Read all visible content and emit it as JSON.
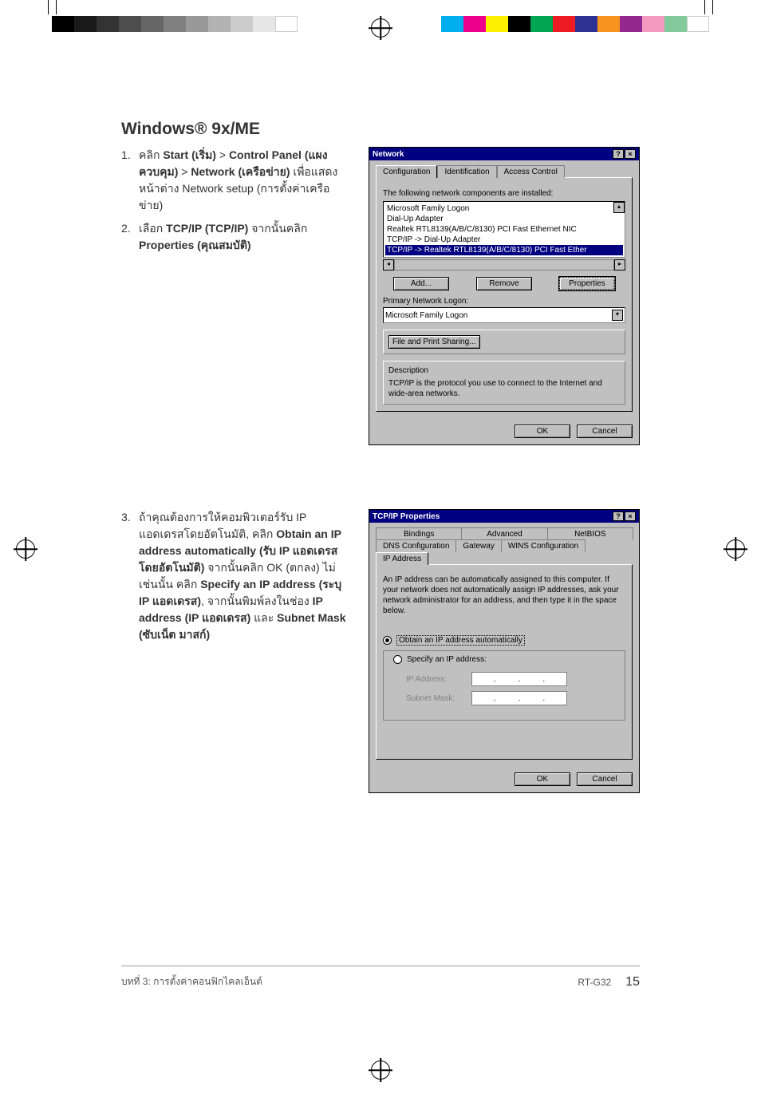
{
  "heading": "Windows® 9x/ME",
  "steps": {
    "s1": {
      "num": "1.",
      "t1": "คลิก ",
      "b1": "Start (เริ่ม)",
      "t2": " > ",
      "b2": "Control Panel (แผงควบคุม)",
      "t3": " > ",
      "b3": "Network (เครือข่าย)",
      "t4": " เพื่อแสดงหน้าต่าง Network setup (การตั้งค่าเครือข่าย)"
    },
    "s2": {
      "num": "2.",
      "t1": "เลือก ",
      "b1": "TCP/IP (TCP/IP)",
      "t2": " จากนั้นคลิก ",
      "b2": "Properties (คุณสมบัติ)"
    },
    "s3": {
      "num": "3.",
      "t1": "ถ้าคุณต้องการให้คอมพิวเตอร์รับ IP แอดเดรสโดยอัตโนมัติ, คลิก ",
      "b1": "Obtain an IP address automatically (รับ IP แอดเดรสโดยอัตโนมัติ)",
      "t2": " จากนั้นคลิก OK (ตกลง) ไม่เช่นนั้น คลิก ",
      "b2": "Specify an IP address (ระบุ IP แอดเดรส)",
      "t3": ", จากนั้นพิมพ์ลงในช่อง ",
      "b3": "IP address (IP แอดเดรส)",
      "t4": " และ ",
      "b4": "Subnet Mask (ซับเน็ต มาสก์)"
    }
  },
  "dlg1": {
    "title": "Network",
    "tabs": {
      "t1": "Configuration",
      "t2": "Identification",
      "t3": "Access Control"
    },
    "components_label": "The following network components are installed:",
    "items": {
      "i1": "Microsoft Family Logon",
      "i2": "Dial-Up Adapter",
      "i3": "Realtek RTL8139(A/B/C/8130) PCI Fast Ethernet NIC",
      "i4": "TCP/IP -> Dial-Up Adapter",
      "i5": "TCP/IP -> Realtek RTL8139(A/B/C/8130) PCI Fast Ether"
    },
    "btn_add": "Add...",
    "btn_remove": "Remove",
    "btn_props": "Properties",
    "primary_label": "Primary Network Logon:",
    "primary_value": "Microsoft Family Logon",
    "btn_fps": "File and Print Sharing...",
    "desc_label": "Description",
    "desc_text": "TCP/IP is the protocol you use to connect to the Internet and wide-area networks.",
    "ok": "OK",
    "cancel": "Cancel"
  },
  "dlg2": {
    "title": "TCP/IP Properties",
    "tabs": {
      "r1a": "Bindings",
      "r1b": "Advanced",
      "r1c": "NetBIOS",
      "r2a": "DNS Configuration",
      "r2b": "Gateway",
      "r2c": "WINS Configuration",
      "r2d": "IP Address"
    },
    "intro": "An IP address can be automatically assigned to this computer. If your network does not automatically assign IP addresses, ask your network administrator for an address, and then type it in the space below.",
    "radio_auto": "Obtain an IP address automatically",
    "radio_spec": "Specify an IP address:",
    "ip_label": "IP Address:",
    "mask_label": "Subnet Mask:",
    "ok": "OK",
    "cancel": "Cancel"
  },
  "footer": {
    "left": "บทที่ 3: การตั้งค่าคอนฟิกไคลเอ็นต์",
    "right": "RT-G32",
    "page": "15"
  },
  "reg_colors_left": [
    "#000",
    "#1a1a1a",
    "#333",
    "#4d4d4d",
    "#666",
    "#808080",
    "#999",
    "#b3b3b3",
    "#ccc",
    "#e6e6e6",
    "#fff"
  ],
  "reg_colors_right": [
    "#00aeef",
    "#ec008c",
    "#fff200",
    "#000",
    "#00a651",
    "#ed1c24",
    "#2e3192",
    "#f7941d",
    "#92278f",
    "#f49ac1",
    "#82ca9c",
    "#fff"
  ]
}
